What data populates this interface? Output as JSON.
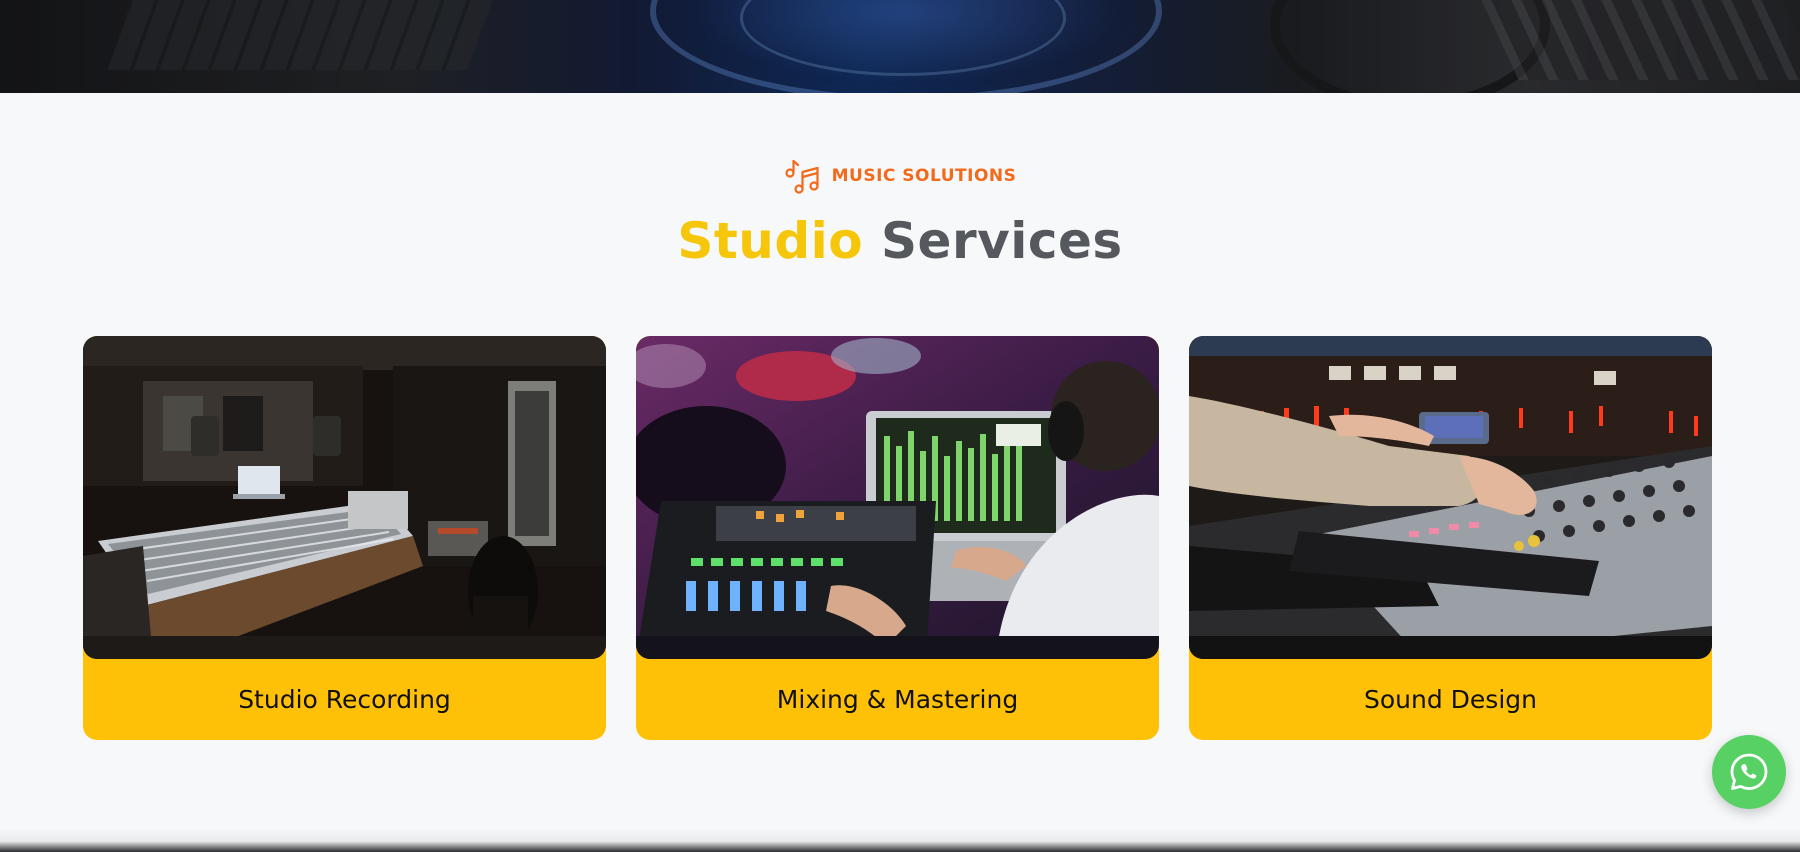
{
  "hero": {
    "image": "studio-equipment-banner"
  },
  "section": {
    "eyebrow_icon": "music-notes-icon",
    "eyebrow_label": "MUSIC SOLUTIONS",
    "heading_accent": "Studio",
    "heading_rest": "Services"
  },
  "services": [
    {
      "title": "Studio Recording",
      "image": "recording-studio-console-photo"
    },
    {
      "title": "Mixing & Mastering",
      "image": "mixing-desk-engineer-photo"
    },
    {
      "title": "Sound Design",
      "image": "mixing-console-hands-photo"
    }
  ],
  "floating": {
    "icon": "whatsapp-icon"
  },
  "colors": {
    "accent": "#f5c60a",
    "eyebrow": "#f26a1b",
    "heading_gray": "#55585c",
    "card_footer": "#ffc107",
    "whatsapp": "#57d163",
    "page_bg": "#f7f8fa"
  }
}
